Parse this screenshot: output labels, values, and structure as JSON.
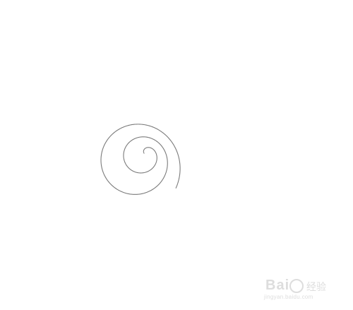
{
  "drawing": {
    "stroke_color": "#7a7a7a",
    "background": "#ffffff"
  },
  "watermark": {
    "logo_text": "Bai",
    "logo_cn": "经验",
    "url": "jingyan.baidu.com",
    "color": "#dddddd"
  }
}
